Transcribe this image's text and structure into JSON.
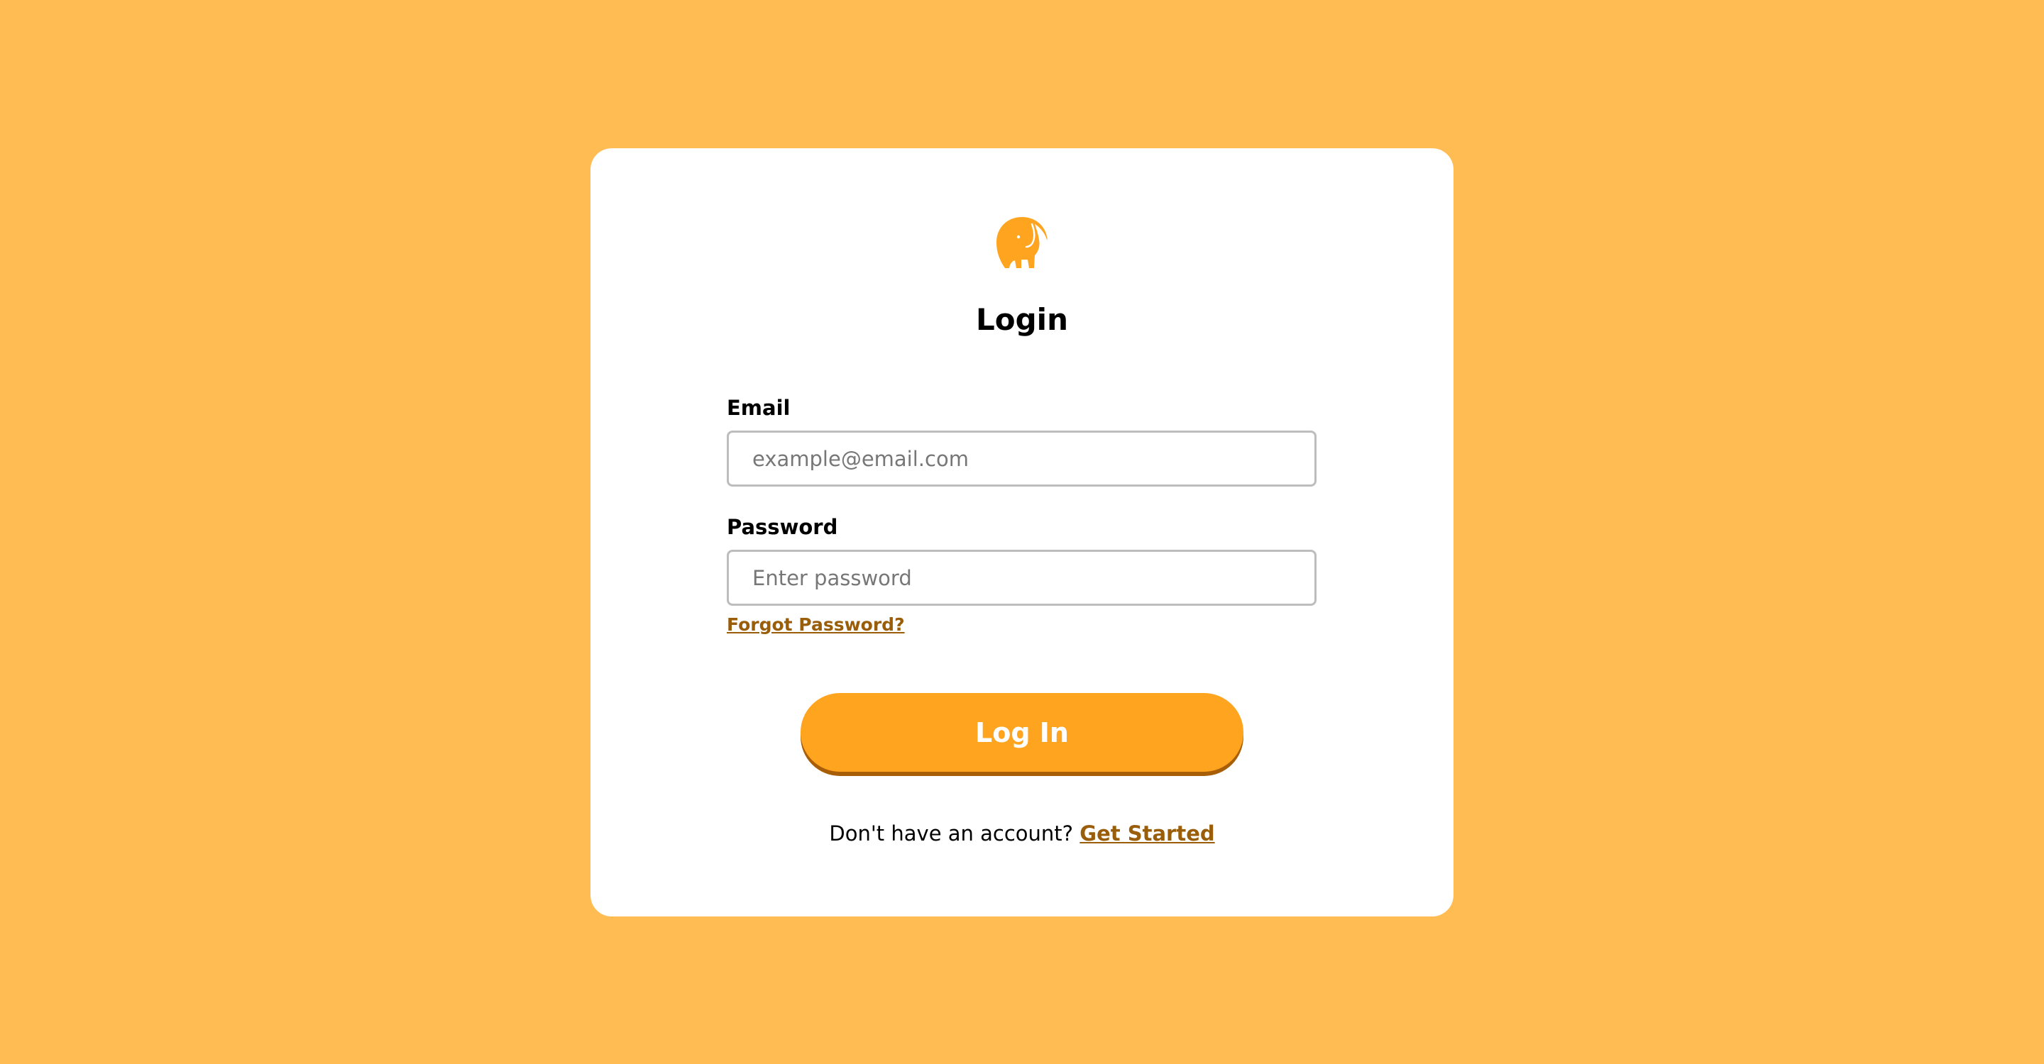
{
  "colors": {
    "page_background": "#FFBC52",
    "card_background": "#FFFFFF",
    "accent": "#FFA41F",
    "accent_shadow": "#A85E06",
    "link": "#9A5E0A",
    "input_border": "#BDBDBD",
    "text": "#000000"
  },
  "logo": {
    "icon": "elephant-icon"
  },
  "login_form": {
    "title": "Login",
    "email": {
      "label": "Email",
      "value": "",
      "placeholder": "example@email.com"
    },
    "password": {
      "label": "Password",
      "value": "",
      "placeholder": "Enter password"
    },
    "forgot_password_label": "Forgot Password?",
    "submit_label": "Log In",
    "signup_prompt": "Don't have an account?",
    "signup_link_label": "Get Started"
  }
}
